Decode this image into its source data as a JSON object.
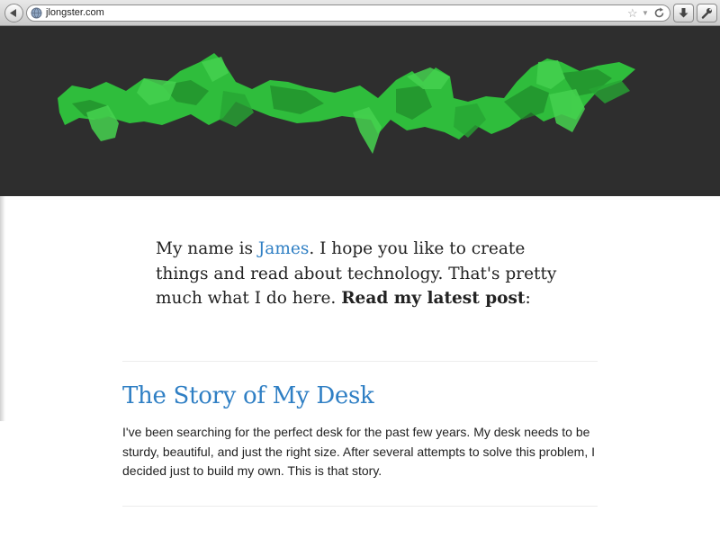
{
  "browser": {
    "url": "jlongster.com",
    "icons": [
      "back-arrow-icon",
      "globe-icon",
      "star-icon",
      "dropdown-arrow-icon",
      "reload-icon",
      "download-icon",
      "wrench-icon"
    ]
  },
  "hero": {
    "image": "green-polygon-ribbon",
    "colors": {
      "background": "#2e2e2e",
      "ribbon": "#2fbd3c",
      "ribbon_dark": "#1f8a2a"
    }
  },
  "intro": {
    "prefix": "My name is ",
    "name_link": "James",
    "middle": ". I hope you like to create things and read about technology. That's pretty much what I do here. ",
    "cta": "Read my latest post",
    "suffix": ":"
  },
  "post": {
    "title": "The Story of My Desk",
    "excerpt": "I've been searching for the perfect desk for the past few years. My desk needs to be sturdy, beautiful, and just the right size. After several attempts to solve this problem, I decided just to build my own. This is that story."
  },
  "colors": {
    "link": "#2f7fc4",
    "text": "#222222"
  }
}
